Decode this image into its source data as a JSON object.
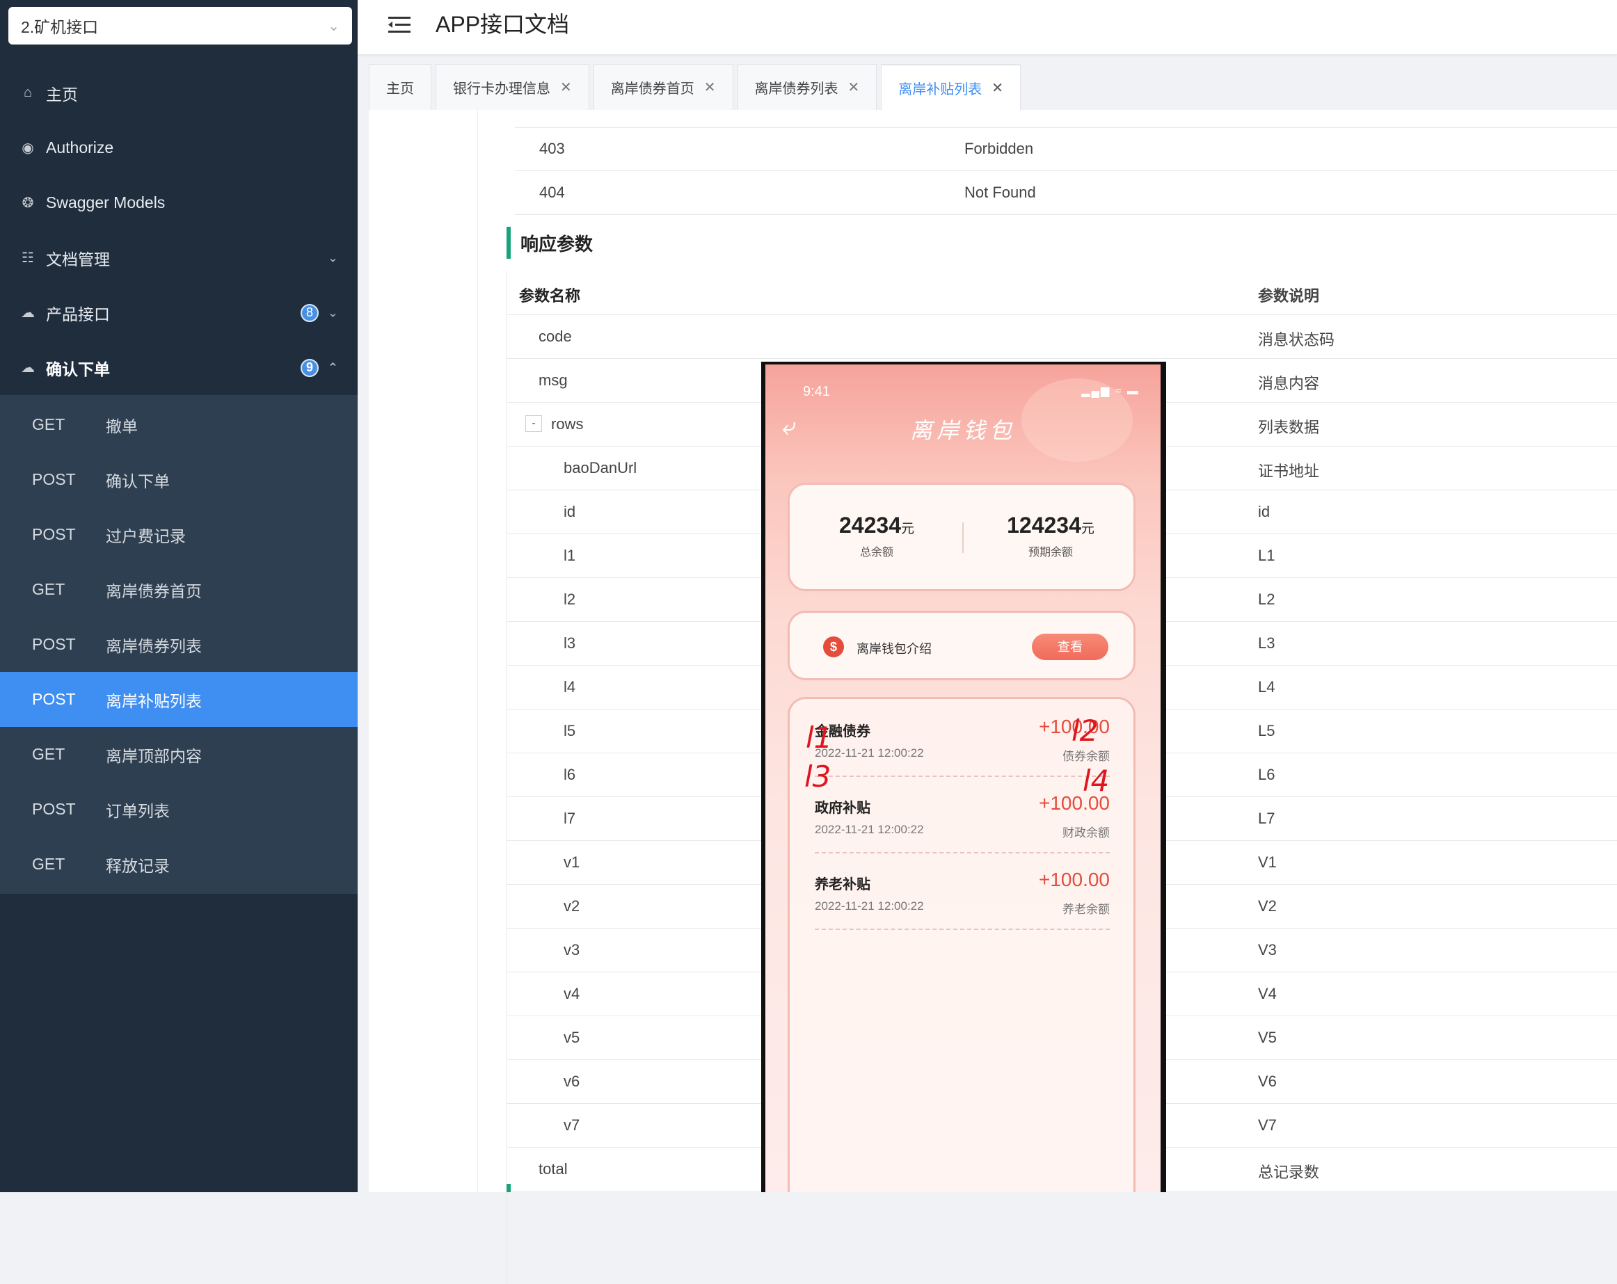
{
  "sidebar": {
    "project_select": "2.矿机接口",
    "nav": [
      {
        "label": "主页",
        "icon": "home-icon"
      },
      {
        "label": "Authorize",
        "icon": "lock-icon"
      },
      {
        "label": "Swagger Models",
        "icon": "cube-icon"
      },
      {
        "label": "文档管理",
        "icon": "document-icon"
      },
      {
        "label": "产品接口",
        "icon": "cloud-icon",
        "badge": "8"
      },
      {
        "label": "确认下单",
        "icon": "cloud-icon",
        "badge": "9"
      }
    ],
    "sub_items": [
      {
        "method": "GET",
        "label": "撤单"
      },
      {
        "method": "POST",
        "label": "确认下单"
      },
      {
        "method": "POST",
        "label": "过户费记录"
      },
      {
        "method": "GET",
        "label": "离岸债券首页"
      },
      {
        "method": "POST",
        "label": "离岸债券列表"
      },
      {
        "method": "POST",
        "label": "离岸补贴列表"
      },
      {
        "method": "GET",
        "label": "离岸顶部内容"
      },
      {
        "method": "POST",
        "label": "订单列表"
      },
      {
        "method": "GET",
        "label": "释放记录"
      }
    ]
  },
  "header": {
    "title": "APP接口文档"
  },
  "tabs": [
    {
      "label": "主页"
    },
    {
      "label": "银行卡办理信息"
    },
    {
      "label": "离岸债券首页"
    },
    {
      "label": "离岸债券列表"
    },
    {
      "label": "离岸补贴列表"
    }
  ],
  "status_rows": [
    {
      "code": "403",
      "desc": "Forbidden"
    },
    {
      "code": "404",
      "desc": "Not Found"
    }
  ],
  "response": {
    "title": "响应参数",
    "col_name": "参数名称",
    "col_desc": "参数说明",
    "toggle": "-",
    "rows": [
      {
        "name": "code",
        "desc": "消息状态码"
      },
      {
        "name": "msg",
        "desc": "消息内容"
      },
      {
        "name": "rows",
        "desc": "列表数据"
      },
      {
        "name": "baoDanUrl",
        "desc": "证书地址"
      },
      {
        "name": "id",
        "desc": "id"
      },
      {
        "name": "l1",
        "desc": "L1"
      },
      {
        "name": "l2",
        "desc": "L2"
      },
      {
        "name": "l3",
        "desc": "L3"
      },
      {
        "name": "l4",
        "desc": "L4"
      },
      {
        "name": "l5",
        "desc": "L5"
      },
      {
        "name": "l6",
        "desc": "L6"
      },
      {
        "name": "l7",
        "desc": "L7"
      },
      {
        "name": "v1",
        "desc": "V1"
      },
      {
        "name": "v2",
        "desc": "V2"
      },
      {
        "name": "v3",
        "desc": "V3"
      },
      {
        "name": "v4",
        "desc": "V4"
      },
      {
        "name": "v5",
        "desc": "V5"
      },
      {
        "name": "v6",
        "desc": "V6"
      },
      {
        "name": "v7",
        "desc": "V7"
      },
      {
        "name": "total",
        "desc": "总记录数"
      }
    ]
  },
  "phone": {
    "time": "9:41",
    "title": "离岸钱包",
    "balance_total": "24234",
    "balance_total_unit": "元",
    "balance_total_label": "总余额",
    "balance_expected": "124234",
    "balance_expected_unit": "元",
    "balance_expected_label": "预期余额",
    "intro_text": "离岸钱包介绍",
    "intro_button": "查看",
    "items": [
      {
        "name": "金融债券",
        "amount": "+100.00",
        "date": "2022-11-21 12:00:22",
        "sub": "债券余额"
      },
      {
        "name": "政府补贴",
        "amount": "+100.00",
        "date": "2022-11-21 12:00:22",
        "sub": "财政余额"
      },
      {
        "name": "养老补贴",
        "amount": "+100.00",
        "date": "2022-11-21 12:00:22",
        "sub": "养老余额"
      }
    ],
    "annotations": [
      "l1",
      "l2",
      "l3",
      "l4"
    ]
  }
}
